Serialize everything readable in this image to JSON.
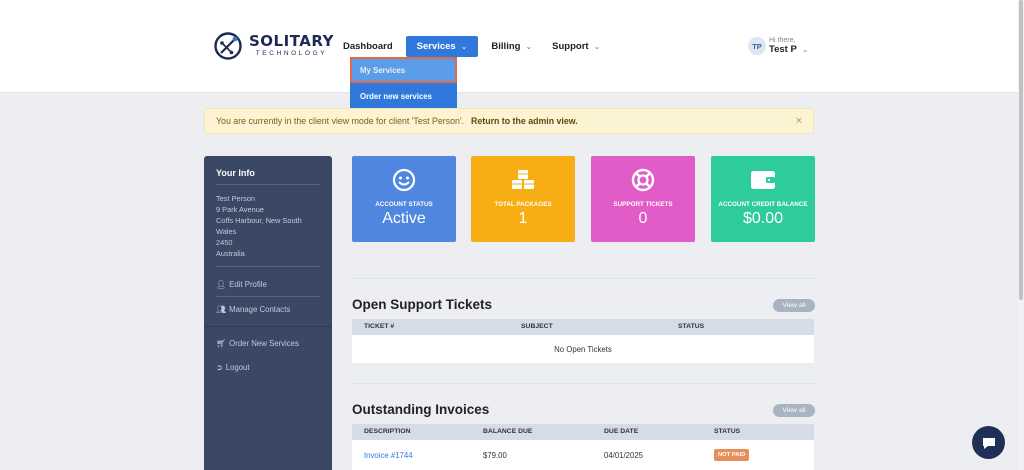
{
  "brand": {
    "name": "SOLITARY",
    "sub": "TECHNOLOGY"
  },
  "nav": [
    {
      "label": "Dashboard"
    },
    {
      "label": "Services"
    },
    {
      "label": "Billing"
    },
    {
      "label": "Support"
    }
  ],
  "services_menu": [
    {
      "label": "My Services"
    },
    {
      "label": "Order new services"
    }
  ],
  "user": {
    "initials": "TP",
    "greeting": "Hi there,",
    "name": "Test P"
  },
  "alert": {
    "text": "You are currently in the client view mode for client 'Test Person'.",
    "link": "Return to the admin view.",
    "close": "×"
  },
  "sidebar": {
    "title": "Your Info",
    "address": [
      "Test Person",
      "9 Park Avenue",
      "Coffs Harbour, New South Wales",
      "2450",
      "Australia"
    ],
    "links": [
      {
        "label": "Edit Profile",
        "icon": "user-icon"
      },
      {
        "label": "Manage Contacts",
        "icon": "users-icon"
      },
      {
        "label": "Order New Services",
        "icon": "cart-icon"
      },
      {
        "label": "Logout",
        "icon": "logout-icon"
      }
    ]
  },
  "cards": [
    {
      "label": "ACCOUNT STATUS",
      "value": "Active",
      "color": "#4f86e0",
      "icon": "smile-icon"
    },
    {
      "label": "TOTAL PACKAGES",
      "value": "1",
      "color": "#f7ae14",
      "icon": "cubes-icon"
    },
    {
      "label": "SUPPORT TICKETS",
      "value": "0",
      "color": "#e25cc7",
      "icon": "lifering-icon"
    },
    {
      "label": "ACCOUNT CREDIT BALANCE",
      "value": "$0.00",
      "color": "#2dcc9a",
      "icon": "wallet-icon"
    }
  ],
  "tickets": {
    "title": "Open Support Tickets",
    "view_all": "View all",
    "columns": [
      "TICKET #",
      "SUBJECT",
      "STATUS"
    ],
    "empty": "No Open Tickets"
  },
  "invoices": {
    "title": "Outstanding Invoices",
    "view_all": "View all",
    "columns": [
      "DESCRIPTION",
      "BALANCE DUE",
      "DUE DATE",
      "STATUS"
    ],
    "rows": [
      {
        "description": "Invoice #1744",
        "balance": "$79.00",
        "due": "04/01/2025",
        "status": "NOT PAID"
      }
    ]
  }
}
